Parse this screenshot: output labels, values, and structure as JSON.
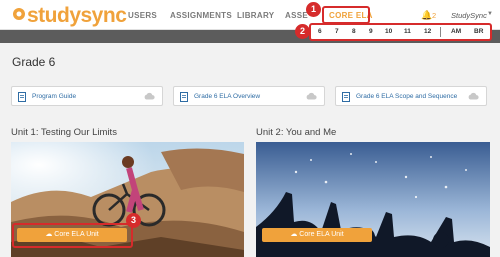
{
  "header": {
    "brand": "studysync",
    "nav": [
      "USERS",
      "ASSIGNMENTS",
      "LIBRARY",
      "ASSE",
      "CORE ELA"
    ],
    "notification_count": "2",
    "user_name": "StudySync"
  },
  "grade_bar": {
    "grades": [
      "6",
      "7",
      "8",
      "9",
      "10",
      "11",
      "12"
    ],
    "extra": [
      "AM",
      "BR"
    ]
  },
  "page": {
    "title": "Grade 6"
  },
  "resources": [
    {
      "label": "Program Guide"
    },
    {
      "label": "Grade 6 ELA Overview"
    },
    {
      "label": "Grade 6 ELA Scope and Sequence"
    }
  ],
  "units": [
    {
      "title": "Unit 1: Testing Our Limits",
      "button": "Core ELA Unit"
    },
    {
      "title": "Unit 2: You and Me",
      "button": "Core ELA Unit"
    }
  ],
  "callouts": [
    "1",
    "2",
    "3"
  ],
  "colors": {
    "brand_orange": "#f0a23b",
    "callout_red": "#d62b2b",
    "grade_bar": "#5c5c5c",
    "link_blue": "#2e6ca4"
  }
}
